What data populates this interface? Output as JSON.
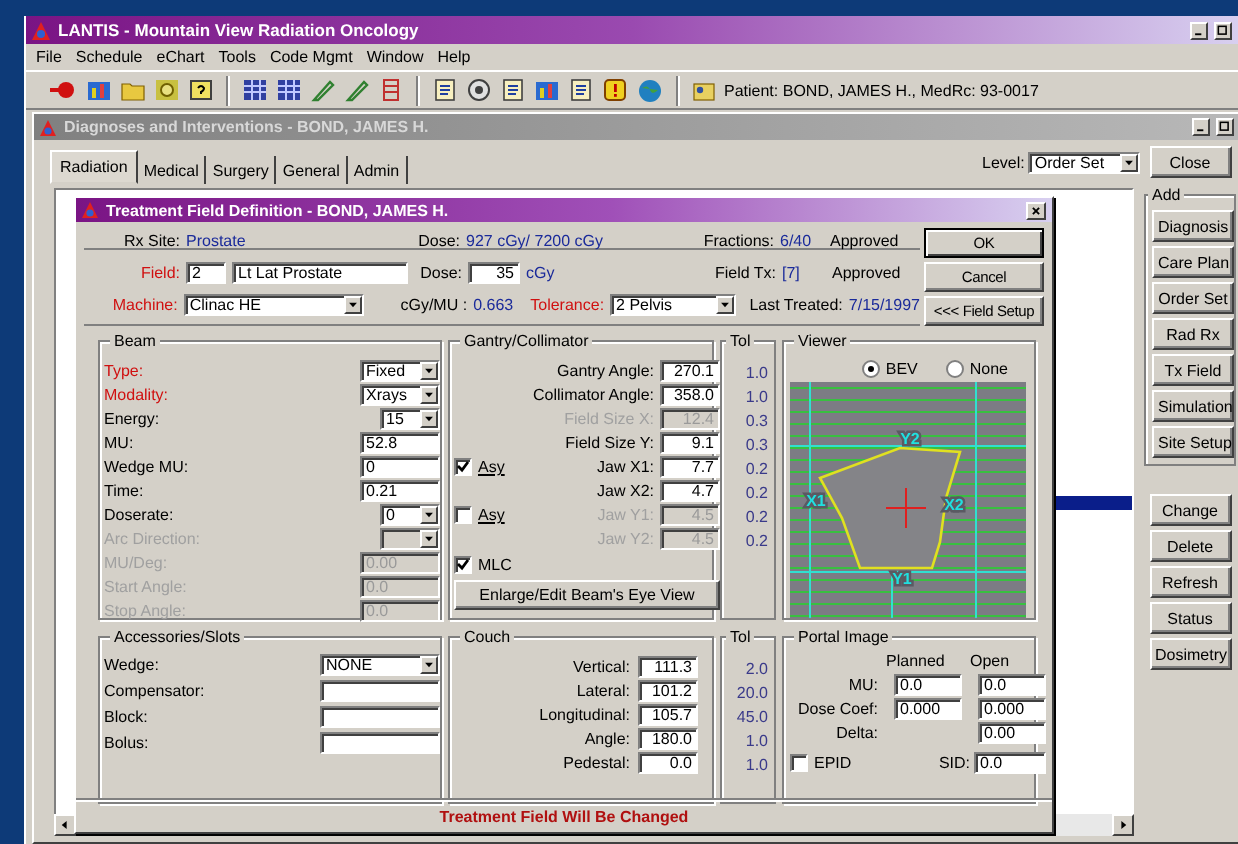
{
  "app_window": {
    "title": "LANTIS - Mountain View Radiation Oncology",
    "menu": [
      "File",
      "Schedule",
      "eChart",
      "Tools",
      "Code Mgmt",
      "Window",
      "Help"
    ],
    "patient": "Patient: BOND, JAMES H.,  MedRc: 93-0017"
  },
  "child_window": {
    "title": "Diagnoses and Interventions - BOND, JAMES H.",
    "tabs": [
      {
        "label": "Radiation",
        "selected": true
      },
      {
        "label": "Medical",
        "selected": false
      },
      {
        "label": "Surgery",
        "selected": false
      },
      {
        "label": "General",
        "selected": false
      },
      {
        "label": "Admin",
        "selected": false
      }
    ],
    "level": {
      "label": "Level:",
      "value": "Order Set"
    },
    "close_button": "Close",
    "add_group": {
      "title": "Add",
      "buttons": [
        "Diagnosis",
        "Care Plan",
        "Order Set",
        "Rad Rx",
        "Tx Field",
        "Simulation",
        "Site Setup"
      ]
    },
    "action_buttons": [
      "Change",
      "Delete",
      "Refresh",
      "Status",
      "Dosimetry"
    ]
  },
  "dialog": {
    "title": "Treatment Field Definition - BOND, JAMES H.",
    "summary": {
      "rx_site_label": "Rx Site:",
      "rx_site": "Prostate",
      "dose_label": "Dose:",
      "dose": "927 cGy/ 7200 cGy",
      "fractions_label": "Fractions:",
      "fractions": "6/40",
      "fractions_status": "Approved"
    },
    "field_row": {
      "field_label": "Field:",
      "field_number": "2",
      "field_name": "Lt Lat Prostate",
      "dose_label": "Dose:",
      "dose": "35",
      "dose_unit": "cGy",
      "field_tx_label": "Field Tx:",
      "field_tx": "[7]",
      "field_tx_status": "Approved"
    },
    "machine_row": {
      "machine_label": "Machine:",
      "machine": "Clinac HE",
      "cgy_mu_label": "cGy/MU :",
      "cgy_mu": "0.663",
      "tolerance_label": "Tolerance:",
      "tolerance": "2 Pelvis",
      "last_treated_label": "Last Treated:",
      "last_treated": "7/15/1997"
    },
    "buttons": [
      "OK",
      "Cancel",
      "<<< Field Setup"
    ],
    "beam": {
      "title": "Beam",
      "fields": [
        {
          "label": "Type:",
          "kind": "select",
          "value": "Fixed",
          "required": true,
          "disabled": false
        },
        {
          "label": "Modality:",
          "kind": "select",
          "value": "Xrays",
          "required": true,
          "disabled": false
        },
        {
          "label": "Energy:",
          "kind": "select",
          "value": "15",
          "required": false,
          "disabled": false
        },
        {
          "label": "MU:",
          "kind": "input",
          "value": "52.8",
          "required": false,
          "disabled": false
        },
        {
          "label": "Wedge MU:",
          "kind": "input",
          "value": "0",
          "required": false,
          "disabled": false
        },
        {
          "label": "Time:",
          "kind": "input",
          "value": "0.21",
          "required": false,
          "disabled": false
        },
        {
          "label": "Doserate:",
          "kind": "select",
          "value": "0",
          "required": false,
          "disabled": false
        },
        {
          "label": "Arc Direction:",
          "kind": "select",
          "required": false,
          "disabled": true
        },
        {
          "label": "MU/Deg:",
          "kind": "input",
          "value": "0.00",
          "required": false,
          "disabled": true
        },
        {
          "label": "Start Angle:",
          "kind": "input",
          "value": "0.0",
          "required": false,
          "disabled": true
        },
        {
          "label": "Stop Angle:",
          "kind": "input",
          "value": "0.0",
          "required": false,
          "disabled": true
        }
      ]
    },
    "gantry": {
      "title": "Gantry/Collimator",
      "tol_header": "Tol",
      "rows": [
        {
          "label": "Gantry Angle:",
          "value": "270.1",
          "tol": "1.0",
          "disabled": false
        },
        {
          "label": "Collimator Angle:",
          "value": "358.0",
          "tol": "1.0",
          "disabled": false
        },
        {
          "label": "Field Size X:",
          "value": "12.4",
          "tol": "0.3",
          "disabled": true
        },
        {
          "label": "Field Size Y:",
          "value": "9.1",
          "tol": "0.3",
          "disabled": false
        },
        {
          "label": "Jaw X1:",
          "value": "7.7",
          "tol": "0.2",
          "disabled": false,
          "asy": {
            "label": "Asy",
            "checked": true
          }
        },
        {
          "label": "Jaw X2:",
          "value": "4.7",
          "tol": "0.2",
          "disabled": false
        },
        {
          "label": "Jaw Y1:",
          "value": "4.5",
          "tol": "0.2",
          "disabled": true,
          "asy": {
            "label": "Asy",
            "checked": false
          }
        },
        {
          "label": "Jaw Y2:",
          "value": "4.5",
          "tol": "0.2",
          "disabled": true
        }
      ],
      "mlc": {
        "label": "MLC",
        "checked": true
      },
      "bev_button": "Enlarge/Edit Beam's Eye View"
    },
    "viewer": {
      "title": "Viewer",
      "modes": [
        {
          "label": "BEV",
          "selected": true
        },
        {
          "label": "None",
          "selected": false
        }
      ],
      "jaw_labels": [
        "Y2",
        "X1",
        "X2",
        "Y1"
      ]
    },
    "accessories": {
      "title": "Accessories/Slots",
      "fields": [
        {
          "label": "Wedge:",
          "kind": "select",
          "value": "NONE"
        },
        {
          "label": "Compensator:",
          "kind": "input"
        },
        {
          "label": "Block:",
          "kind": "input"
        },
        {
          "label": "Bolus:",
          "kind": "input"
        }
      ]
    },
    "couch": {
      "title": "Couch",
      "tol_header": "Tol",
      "rows": [
        {
          "label": "Vertical:",
          "value": "111.3",
          "tol": "2.0"
        },
        {
          "label": "Lateral:",
          "value": "101.2",
          "tol": "20.0"
        },
        {
          "label": "Longitudinal:",
          "value": "105.7",
          "tol": "45.0"
        },
        {
          "label": "Angle:",
          "value": "180.0",
          "tol": "1.0"
        },
        {
          "label": "Pedestal:",
          "value": "0.0",
          "tol": "1.0"
        }
      ]
    },
    "portal": {
      "title": "Portal Image",
      "columns": [
        "Planned",
        "Open"
      ],
      "rows": [
        {
          "label": "MU:",
          "planned": "0.0",
          "open": "0.0"
        },
        {
          "label": "Dose Coef:",
          "planned": "0.000",
          "open": "0.000"
        },
        {
          "label": "Delta:",
          "open": "0.00"
        }
      ],
      "epid": {
        "label": "EPID",
        "checked": false
      },
      "sid_label": "SID:",
      "sid": "0.0"
    },
    "status_message": "Treatment Field Will Be Changed"
  }
}
